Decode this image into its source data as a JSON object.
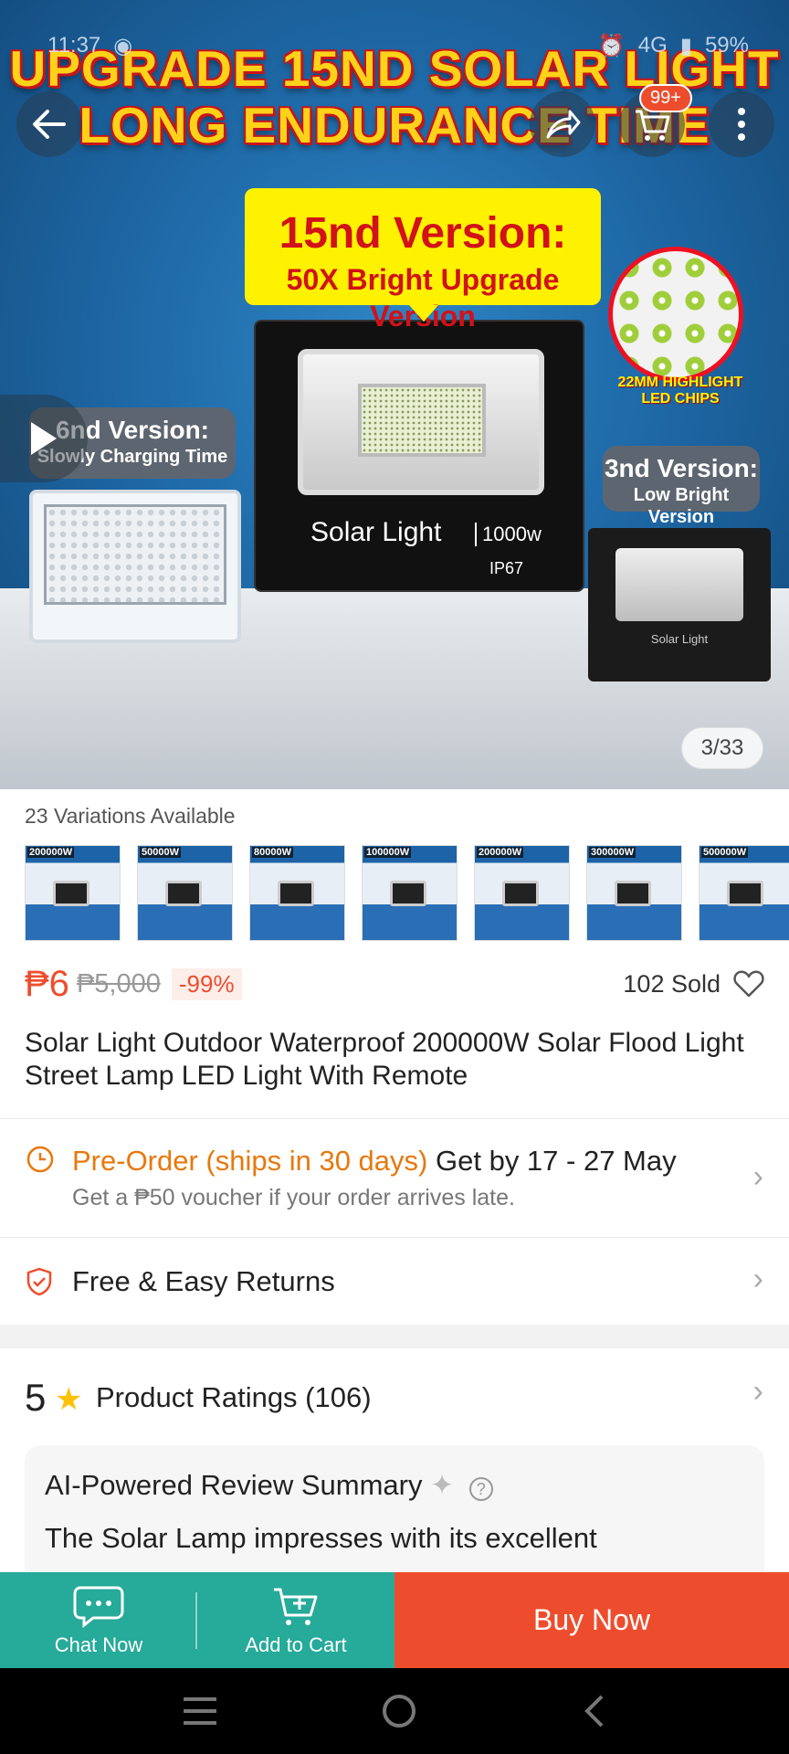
{
  "status_bar": {
    "time": "11:37",
    "network": "4G",
    "battery": "59%"
  },
  "hero": {
    "headline_line1": "UPGRADE 15ND SOLAR LIGHT",
    "headline_line2": "LONG ENDURANCE TIME",
    "callout_title": "15nd Version:",
    "callout_subtitle": "50X Bright Upgrade Version",
    "main_lamp_label": "Solar Light",
    "main_lamp_watt": "1000w",
    "main_lamp_rating": "IP67",
    "chip_label": "22MM HIGHLIGHT LED CHIPS",
    "left_version_title": "6nd Version:",
    "left_version_sub": "Slowly Charging Time",
    "right_version_title": "3nd Version:",
    "right_version_sub": "Low Bright Version",
    "right_lamp_text": "Solar Light",
    "image_counter": "3/33"
  },
  "header": {
    "cart_badge": "99+"
  },
  "variations": {
    "label": "23 Variations Available",
    "items": [
      "200000W",
      "50000W",
      "80000W",
      "100000W",
      "200000W",
      "300000W",
      "500000W"
    ]
  },
  "price": {
    "current": "₱6",
    "original": "₱5,000",
    "discount": "-99%",
    "sold": "102 Sold"
  },
  "product_title": "Solar Light Outdoor Waterproof 200000W Solar Flood Light Street Lamp LED Light With Remote",
  "shipping": {
    "preorder_label": "Pre-Order (ships in 30 days)",
    "delivery": "Get by 17 - 27 May",
    "voucher_note": "Get a ₱50 voucher if your order arrives late."
  },
  "returns": {
    "label": "Free & Easy Returns"
  },
  "ratings": {
    "score": "5",
    "label": "Product Ratings (106)",
    "summary_title": "AI-Powered Review Summary",
    "summary_text": "The Solar Lamp impresses with its excellent"
  },
  "bottom_bar": {
    "chat_label": "Chat Now",
    "cart_label": "Add to Cart",
    "buy_label": "Buy Now"
  },
  "colors": {
    "accent": "#ee4d2d",
    "teal": "#26aa99",
    "preorder": "#e8780d"
  }
}
